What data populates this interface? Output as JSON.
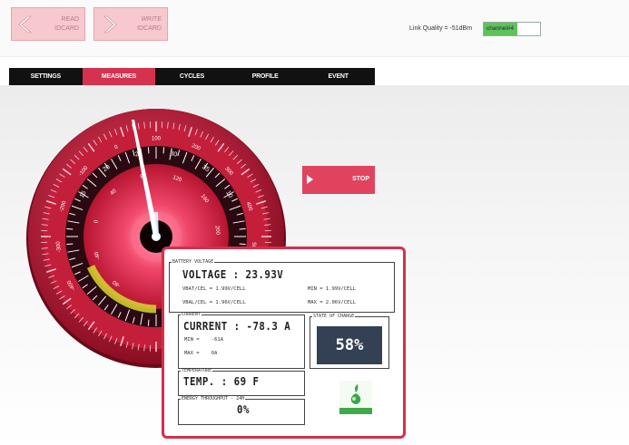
{
  "toolbar": {
    "read_label": "READ\nIDCARD",
    "write_label": "WRITE\nIDCARD"
  },
  "status": {
    "link_quality": "Link Quality = -51dBm",
    "channel_label": "channel#4",
    "link_quality_fill": 0.6,
    "accent_color": "#5ec25a"
  },
  "tabs": [
    {
      "label": "SETTINGS",
      "active": false
    },
    {
      "label": "MEASURES",
      "active": true
    },
    {
      "label": "CYCLES",
      "active": false
    },
    {
      "label": "PROFILE",
      "active": false
    },
    {
      "label": "EVENT",
      "active": false
    }
  ],
  "gauge": {
    "outer_labels": [
      "-400",
      "-300",
      "-200",
      "-100",
      "0",
      "100",
      "200",
      "300",
      "400",
      "500",
      "-500"
    ],
    "middle_labels": [
      "15",
      "20",
      "25",
      "30",
      "35",
      "10"
    ],
    "inner_labels": [
      "-80",
      "-40",
      "0",
      "40",
      "80",
      "120",
      "160",
      "200",
      "240"
    ],
    "needle_outer": "-78.3",
    "colors": {
      "brand": "#d4324f",
      "dark": "#2a0a10",
      "yellow_band": "#d8d830",
      "face": "#ef3d5d"
    }
  },
  "actions": {
    "stop_label": "STOP"
  },
  "panel": {
    "battery_voltage": {
      "legend": "BATTERY VOLTAGE",
      "voltage": "VOLTAGE : 23.93V",
      "vbat_cell": "VBAT/CEL = 1.99V/CELL",
      "vbal_cell": "VBAL/CEL = 1.96V/CELL",
      "min": "MIN = 1.99V/CELL",
      "max": "MAX = 2.06V/CELL"
    },
    "current": {
      "legend": "CURRENT",
      "value": "CURRENT : -78.3 A",
      "min": "MIN =    -61A",
      "max": "MAX =    0A"
    },
    "state_of_charge": {
      "legend": "STATE OF CHARGE",
      "value": "58%"
    },
    "temperature": {
      "legend": "TEMPERATURE",
      "value": "TEMP. : 69 F"
    },
    "energy": {
      "legend": "ENERGY THROUGHPUT - 24H",
      "value": "0%"
    },
    "icon": "eco-leaf-icon"
  }
}
